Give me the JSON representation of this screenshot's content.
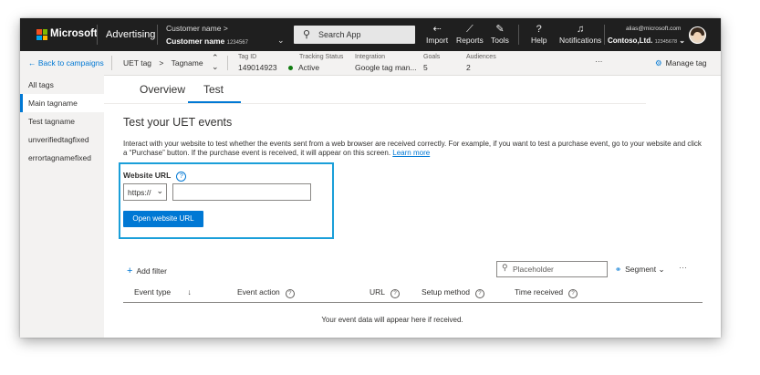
{
  "topbar": {
    "brand": "Microsoft",
    "product": "Advertising",
    "customer_label": "Customer name",
    "customer_chevron": ">",
    "customer_name": "Customer name",
    "customer_id": "1234567",
    "search_placeholder": "Search App",
    "buttons": [
      {
        "label": "Import",
        "icon": "import-icon"
      },
      {
        "label": "Reports",
        "icon": "reports-icon"
      },
      {
        "label": "Tools",
        "icon": "tools-icon"
      },
      {
        "label": "Help",
        "icon": "help-icon"
      },
      {
        "label": "Notifications",
        "icon": "bell-icon"
      }
    ],
    "account_email": "alias@microsoft.com",
    "account_name": "Contoso,Ltd.",
    "account_id": "12345678"
  },
  "subbar": {
    "back": "Back to campaigns",
    "crumb_parent": "UET tag",
    "crumb_sep": ">",
    "crumb_current": "Tagname",
    "fields": [
      {
        "label": "Tag ID",
        "value": "149014923"
      },
      {
        "label": "Tracking Status",
        "value": "Active"
      },
      {
        "label": "Integration",
        "value": "Google tag man..."
      },
      {
        "label": "Goals",
        "value": "5"
      },
      {
        "label": "Audiences",
        "value": "2"
      }
    ],
    "ellipsis": "···",
    "manage": "Manage tag"
  },
  "sidebar": {
    "items": [
      {
        "label": "All tags"
      },
      {
        "label": "Main tagname"
      },
      {
        "label": "Test tagname"
      },
      {
        "label": "unverifiedtagfixed"
      },
      {
        "label": "errortagnamefixed"
      }
    ]
  },
  "main": {
    "tabs": [
      {
        "label": "Overview"
      },
      {
        "label": "Test"
      }
    ],
    "heading": "Test your UET events",
    "description": "Interact with your website to test whether the events sent from a web browser are received correctly. For example, if you want to test a purchase event, go to your website and click a “Purchase” button. If the purchase event is received, it will appear on this screen.",
    "learn_more": "Learn more",
    "website_url_label": "Website URL",
    "protocol": "https://",
    "url_value": "",
    "open_button": "Open website URL",
    "add_filter": "Add filter",
    "filter_placeholder": "Placeholder",
    "segment": "Segment",
    "more": "···",
    "columns": [
      "Event type",
      "Event action",
      "URL",
      "Setup method",
      "Time received"
    ],
    "empty_message": "Your event data will appear here if received."
  },
  "colors": {
    "accent": "#0078d4",
    "highlight": "#1a9fd9",
    "topbar": "#1f1f1f",
    "active": "#107c10"
  }
}
